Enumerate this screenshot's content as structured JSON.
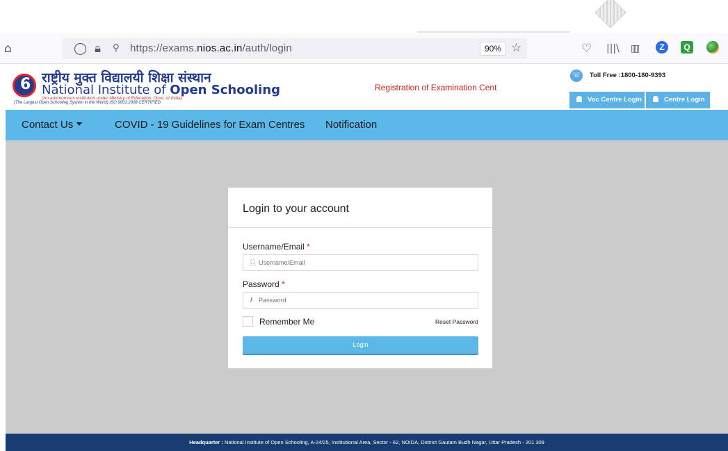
{
  "browser": {
    "url_prefix": "https://exams.",
    "url_domain": "nios.ac.in",
    "url_path": "/auth/login",
    "zoom": "90%"
  },
  "header": {
    "logo_hindi": "राष्ट्रीय मुक्त विद्यालयी शिक्षा संस्थान",
    "logo_english_a": "National Institute of ",
    "logo_english_b": "Open Schooling",
    "logo_sub1": "(An autonomous institution under Ministry of Education, Govt. of India)",
    "logo_sub2": "(The Largest Open Schooling System in the World)  ISO 9001:2008 CERTIFIED",
    "registration_text": "Registration of Examination Cent",
    "toll_free": "Toll Free :1800-180-9393",
    "voc_login": "Voc Centre Login",
    "centre_login": "Centre Login"
  },
  "nav": {
    "contact": "Contact Us",
    "covid": "COVID - 19 Guidelines for Exam Centres",
    "notification": "Notification"
  },
  "login": {
    "title": "Login to your account",
    "username_label": "Username/Email",
    "username_placeholder": "Username/Email",
    "password_label": "Password",
    "password_placeholder": "Password",
    "required_mark": "*",
    "remember": "Remember Me",
    "reset": "Reset Password",
    "button": "Login"
  },
  "footer": {
    "label": "Headquarter :",
    "address": " National Institute of Open Schooling, A-24/25, Institutional Area, Sector - 62, NOIDA, District Gautam Budh Nagar, Uttar Pradesh - 201 309"
  }
}
